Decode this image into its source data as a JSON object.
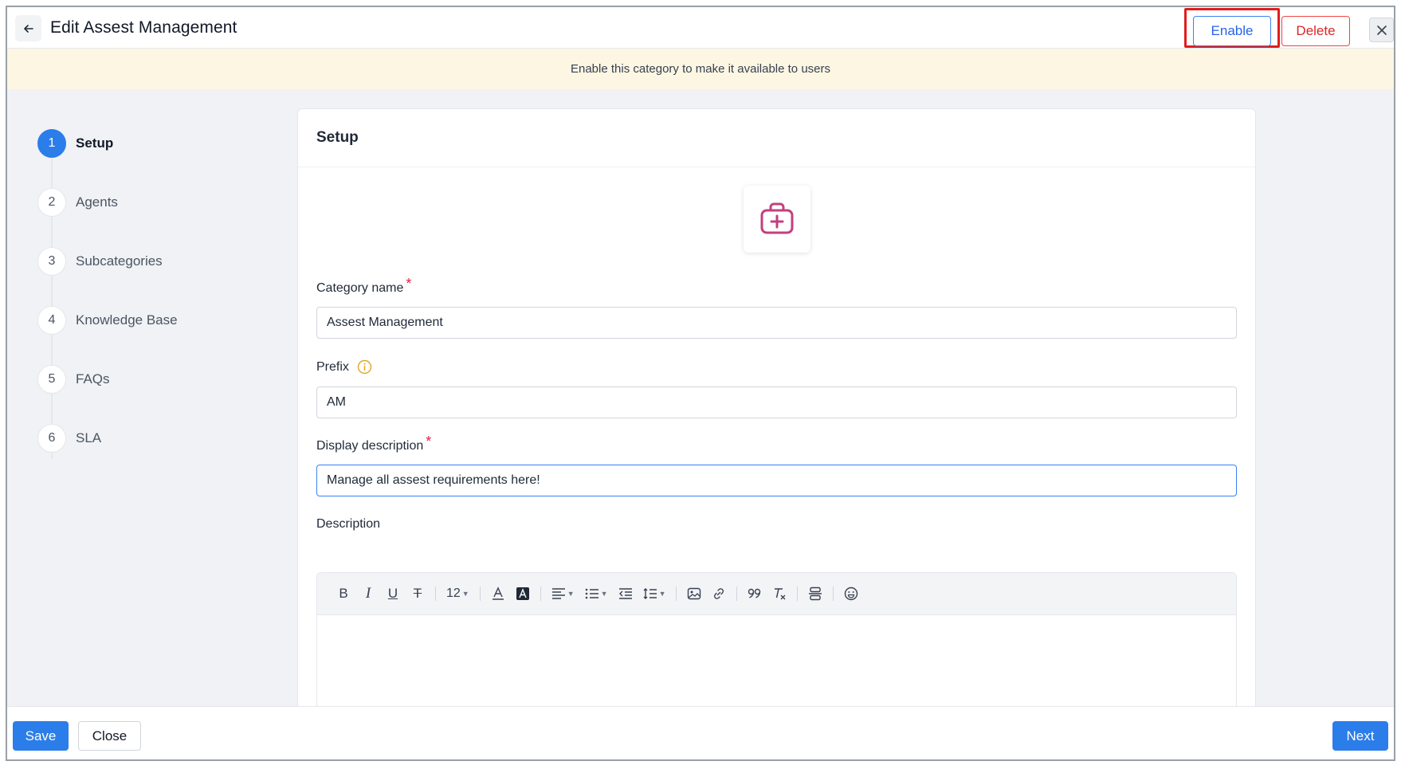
{
  "header": {
    "title": "Edit Assest Management",
    "enable_label": "Enable",
    "delete_label": "Delete"
  },
  "banner": {
    "text": "Enable this category to make it available to users"
  },
  "stepper": {
    "steps": [
      {
        "num": "1",
        "label": "Setup"
      },
      {
        "num": "2",
        "label": "Agents"
      },
      {
        "num": "3",
        "label": "Subcategories"
      },
      {
        "num": "4",
        "label": "Knowledge Base"
      },
      {
        "num": "5",
        "label": "FAQs"
      },
      {
        "num": "6",
        "label": "SLA"
      }
    ]
  },
  "card": {
    "title": "Setup",
    "category_name": {
      "label": "Category name",
      "value": "Assest Management"
    },
    "prefix": {
      "label": "Prefix",
      "value": "AM"
    },
    "display_description": {
      "label": "Display description",
      "value": "Manage all assest requirements here!"
    },
    "description": {
      "label": "Description"
    },
    "font_size": "12",
    "required_mark": "*"
  },
  "toolbar": {
    "bold": "B",
    "italic": "I",
    "underline": "U",
    "strike": "T"
  },
  "footer": {
    "save_label": "Save",
    "close_label": "Close",
    "next_label": "Next"
  },
  "colors": {
    "primary": "#2b7de9",
    "danger": "#dc2626",
    "banner_bg": "#fdf6e3",
    "icon_accent": "#c2407c",
    "info_accent": "#e0a526"
  }
}
